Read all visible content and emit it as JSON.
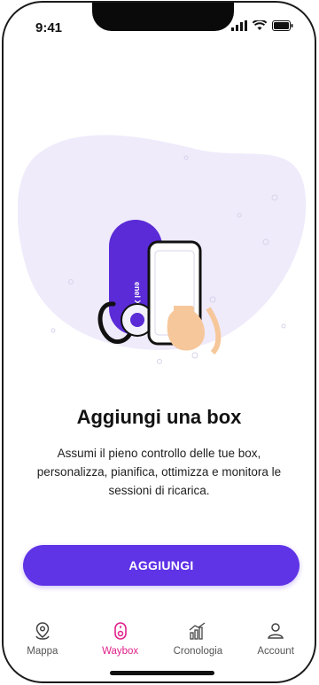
{
  "status_bar": {
    "time": "9:41",
    "icons": [
      "signal-icon",
      "wifi-icon",
      "battery-icon"
    ]
  },
  "illustration": {
    "charger_brand_text": "enel X way",
    "icons": [
      "charger-illustration",
      "phone-in-hand-illustration"
    ]
  },
  "content": {
    "title": "Aggiungi una box",
    "description": "Assumi il pieno controllo delle tue box, personalizza, pianifica, ottimizza e monitora le sessioni di ricarica."
  },
  "cta": {
    "label": "AGGIUNGI"
  },
  "tabbar": {
    "active_index": 1,
    "items": [
      {
        "label": "Mappa",
        "icon": "map-pin-icon"
      },
      {
        "label": "Waybox",
        "icon": "waybox-icon"
      },
      {
        "label": "Cronologia",
        "icon": "chart-icon"
      },
      {
        "label": "Account",
        "icon": "user-icon"
      }
    ]
  },
  "colors": {
    "accent": "#5F33E6",
    "active_tab": "#E0228A",
    "blob": "#EFEBFB",
    "charger": "#5A2BD6"
  }
}
